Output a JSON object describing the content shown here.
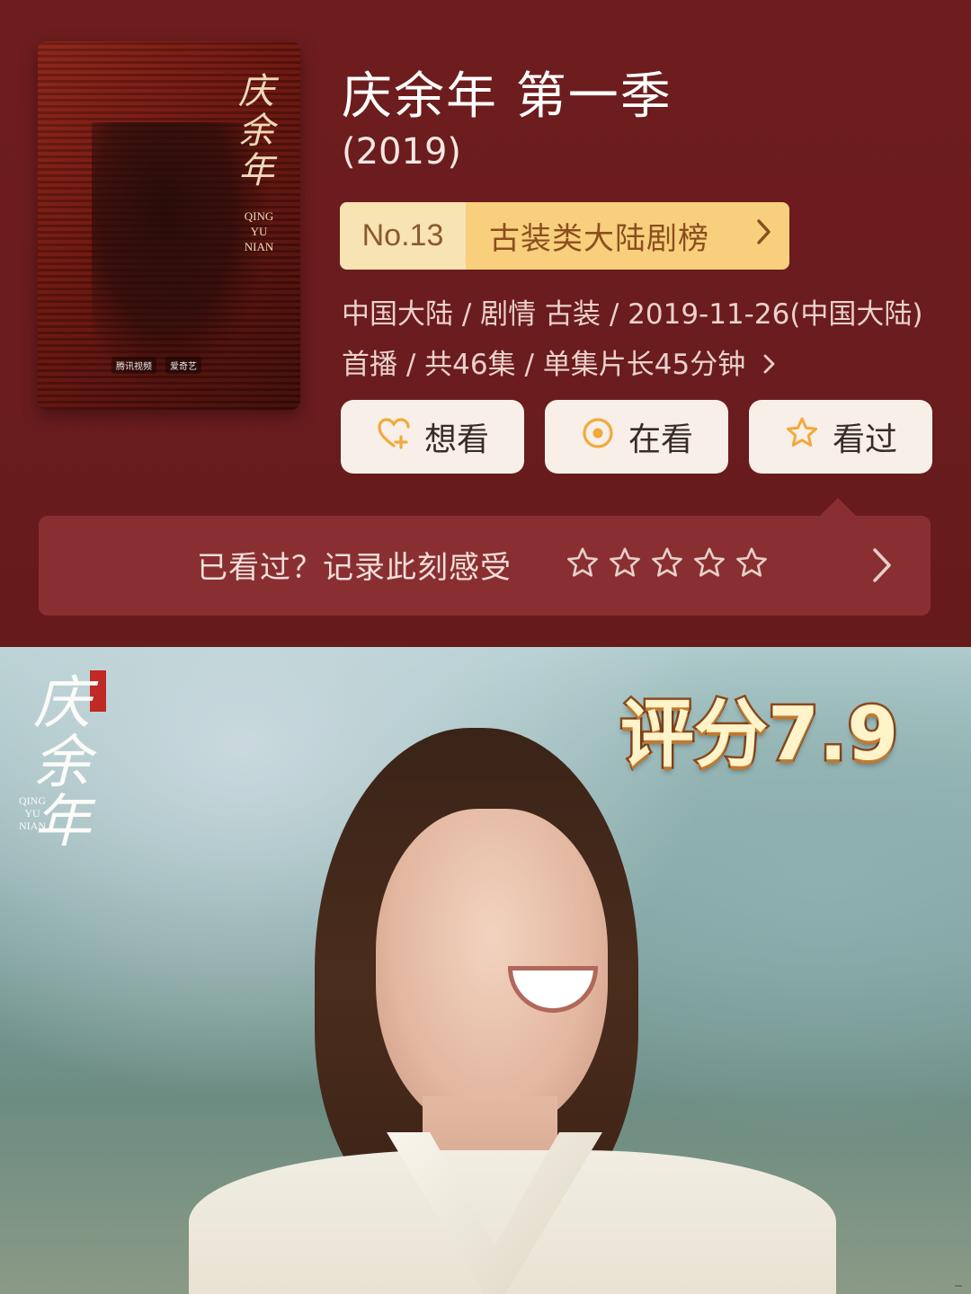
{
  "detail": {
    "title": "庆余年 第一季",
    "year": "(2019)",
    "rank": {
      "number": "No.13",
      "label": "古装类大陆剧榜"
    },
    "meta_line1": "中国大陆 / 剧情 古装 / 2019-11-26(中国大陆)",
    "meta_line2": "首播 / 共46集 / 单集片长45分钟"
  },
  "poster": {
    "calligraphy": "庆余年",
    "pinyin_1": "QING",
    "pinyin_2": "YU",
    "pinyin_3": "NIAN",
    "logo_tencent": "腾讯视频",
    "logo_iqiyi": "爱奇艺"
  },
  "actions": {
    "want_label": "想看",
    "watching_label": "在看",
    "watched_label": "看过"
  },
  "rating_bar": {
    "prompt": "已看过？记录此刻感受",
    "stars_selected": 0,
    "stars_total": 5
  },
  "photo": {
    "calligraphy": "庆余年",
    "pinyin_1": "QING",
    "pinyin_2": "YU",
    "pinyin_3": "NIAN",
    "score_overlay": "评分7.9"
  },
  "icons": {
    "rank_chevron": "chevron-right-icon",
    "want": "heart-plus-icon",
    "watching": "circle-dot-icon",
    "watched": "star-icon",
    "rating_star": "star-outline-icon",
    "rate_chevron": "chevron-right-icon"
  },
  "colors": {
    "background": "#6b1d1f",
    "rank_accent": "#f8cf7d",
    "button_bg": "#f7efe8",
    "icon_accent": "#f2a93b"
  }
}
